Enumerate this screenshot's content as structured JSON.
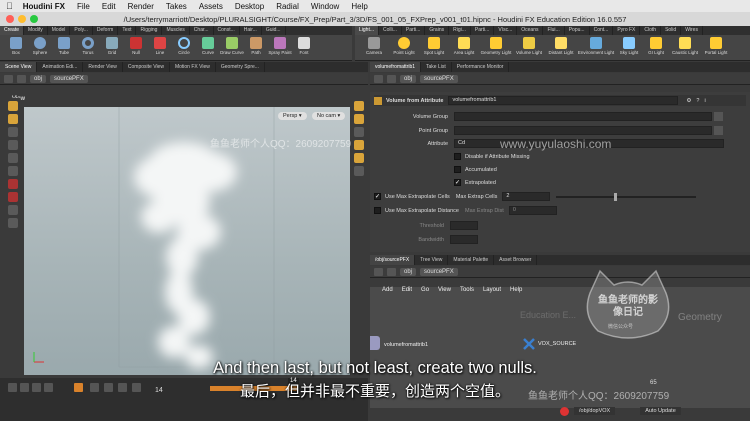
{
  "menubar": {
    "app": "Houdini FX",
    "items": [
      "File",
      "Edit",
      "Render",
      "Takes",
      "Assets",
      "Desktop",
      "Radial",
      "Window",
      "Help"
    ]
  },
  "window": {
    "title": "/Users/terrymarriott/Desktop/PLURALSIGHT/Course/FX_Prep/Part_3/3D/FS_001_05_FXPrep_v001_t01.hipnc - Houdini FX Education Edition 16.0.557"
  },
  "shelf_left": {
    "tabs": [
      "Create",
      "Modify",
      "Model",
      "Poly...",
      "Deform",
      "Text",
      "Rigging",
      "Muscles",
      "Char...",
      "Const...",
      "Hair...",
      "Guid..."
    ],
    "tools": [
      "Box",
      "Sphere",
      "Tube",
      "Torus",
      "Grid",
      "Null",
      "Line",
      "Circle",
      "Curve",
      "Draw Curve",
      "Path",
      "Spray Paint",
      "Font"
    ]
  },
  "shelf_right": {
    "tabs": [
      "Light...",
      "Colli...",
      "Parti...",
      "Grains",
      "Rigi...",
      "Parti...",
      "Vísc...",
      "Oceans",
      "Flui...",
      "Popu...",
      "Cont...",
      "Pyro FX",
      "Cloth",
      "Solid",
      "Wires"
    ],
    "tools": [
      "Camera",
      "Point Light",
      "Spot Light",
      "Area Light",
      "Geometry Light",
      "Volume Light",
      "Distant Light",
      "Environment Light",
      "Sky Light",
      "GI Light",
      "Caustic Light",
      "Portal Light"
    ]
  },
  "left_pane": {
    "tabs": [
      "Scene View",
      "Animation Edi...",
      "Render View",
      "Composite View",
      "Motion FX View",
      "Geometry Spre..."
    ],
    "path": [
      "obj",
      "sourcePFX"
    ],
    "viewport_label": "View",
    "persp": "Persp ▾",
    "cam": "No cam ▾"
  },
  "right_pane": {
    "tabs": [
      "volumefromattrib1",
      "Take List",
      "Performance Monitor"
    ],
    "path": [
      "obj",
      "sourcePFX"
    ],
    "node_type": "Volume from Attribute",
    "node_name": "volumefromattrib1",
    "params": {
      "volume_group": "Volume Group",
      "point_group": "Point Group",
      "attribute_label": "Attribute",
      "attribute_value": "Cd",
      "disable_if_missing": "Disable if Attribute Missing",
      "accumulated": "Accumulated",
      "extrapolated": "Extrapolated",
      "use_max_cells": "Use Max Extrapolate Cells",
      "max_cells_label": "Max Extrap Cells",
      "max_cells_value": "2",
      "use_max_distance": "Use Max Extrapolate Distance",
      "max_dist_label": "Max Extrap Dist",
      "max_dist_value": "0",
      "threshold": "Threshold",
      "bandwidth": "Bandwidth"
    },
    "checks": {
      "extrapolated": true,
      "use_max_cells": true,
      "disable_if_missing": false,
      "accumulated": false,
      "use_max_distance": false
    }
  },
  "network_pane": {
    "tabs": [
      "/obj/sourcePFX",
      "Tree View",
      "Material Palette",
      "Asset Browser"
    ],
    "path": [
      "obj",
      "sourcePFX"
    ],
    "menu": [
      "Add",
      "Edit",
      "Go",
      "View",
      "Tools",
      "Layout",
      "Help"
    ],
    "watermark_left": "Education E...",
    "watermark_right": "Geometry",
    "nodes": {
      "node1": "volumefromattrib1",
      "node2": "VOX_SOURCE"
    }
  },
  "timeline": {
    "frame": "14",
    "marker": "14",
    "end": "65"
  },
  "statusbar": {
    "path": "/obj/dopVOX",
    "update": "Auto Update"
  },
  "subtitles": {
    "en": "And then last, but not least, create two nulls.",
    "zh": "最后，但并非最不重要，创造两个空值。"
  },
  "watermarks": {
    "qq_text": "鱼鱼老师个人QQ：2609207759",
    "site": "www.yuyulaoshi.com",
    "logo_main": "鱼鱼老师的影像日记",
    "logo_sub": "微信公众号"
  },
  "colors": {
    "accent_blue": "#2d6fc1",
    "node_blue": "#3a7fd0"
  }
}
